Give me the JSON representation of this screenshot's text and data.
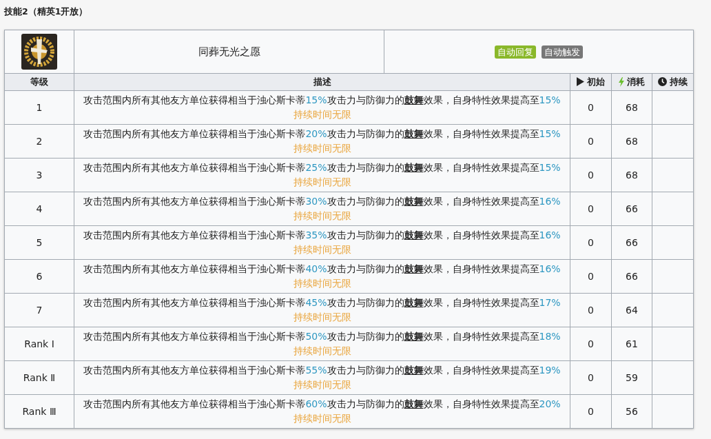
{
  "section_title": "技能2（精英1开放）",
  "skill": {
    "name": "同葬无光之愿",
    "tags": [
      {
        "label": "自动回复",
        "color": "#8ab82a"
      },
      {
        "label": "自动触发",
        "color": "#777777"
      }
    ]
  },
  "columns": [
    {
      "label": "等级"
    },
    {
      "label": "描述"
    },
    {
      "label": "初始"
    },
    {
      "label": "消耗"
    },
    {
      "label": "持续"
    }
  ],
  "rows": [
    {
      "level": "1",
      "description": [
        {
          "kind": "text",
          "text": "攻击范围内所有其他友方单位获得相当于浊心斯卡蒂"
        },
        {
          "kind": "value",
          "text": "15%"
        },
        {
          "kind": "text",
          "text": "攻击力与防御力的"
        },
        {
          "kind": "term",
          "text": "鼓舞"
        },
        {
          "kind": "text",
          "text": "效果，自身特性效果提高至"
        },
        {
          "kind": "value",
          "text": "15%"
        }
      ],
      "duration_note": "持续时间无限",
      "initial": "0",
      "cost": "68"
    },
    {
      "level": "2",
      "description": [
        {
          "kind": "text",
          "text": "攻击范围内所有其他友方单位获得相当于浊心斯卡蒂"
        },
        {
          "kind": "value",
          "text": "20%"
        },
        {
          "kind": "text",
          "text": "攻击力与防御力的"
        },
        {
          "kind": "term",
          "text": "鼓舞"
        },
        {
          "kind": "text",
          "text": "效果，自身特性效果提高至"
        },
        {
          "kind": "value",
          "text": "15%"
        }
      ],
      "duration_note": "持续时间无限",
      "initial": "0",
      "cost": "68"
    },
    {
      "level": "3",
      "description": [
        {
          "kind": "text",
          "text": "攻击范围内所有其他友方单位获得相当于浊心斯卡蒂"
        },
        {
          "kind": "value",
          "text": "25%"
        },
        {
          "kind": "text",
          "text": "攻击力与防御力的"
        },
        {
          "kind": "term",
          "text": "鼓舞"
        },
        {
          "kind": "text",
          "text": "效果，自身特性效果提高至"
        },
        {
          "kind": "value",
          "text": "15%"
        }
      ],
      "duration_note": "持续时间无限",
      "initial": "0",
      "cost": "68"
    },
    {
      "level": "4",
      "description": [
        {
          "kind": "text",
          "text": "攻击范围内所有其他友方单位获得相当于浊心斯卡蒂"
        },
        {
          "kind": "value",
          "text": "30%"
        },
        {
          "kind": "text",
          "text": "攻击力与防御力的"
        },
        {
          "kind": "term",
          "text": "鼓舞"
        },
        {
          "kind": "text",
          "text": "效果，自身特性效果提高至"
        },
        {
          "kind": "value",
          "text": "16%"
        }
      ],
      "duration_note": "持续时间无限",
      "initial": "0",
      "cost": "66"
    },
    {
      "level": "5",
      "description": [
        {
          "kind": "text",
          "text": "攻击范围内所有其他友方单位获得相当于浊心斯卡蒂"
        },
        {
          "kind": "value",
          "text": "35%"
        },
        {
          "kind": "text",
          "text": "攻击力与防御力的"
        },
        {
          "kind": "term",
          "text": "鼓舞"
        },
        {
          "kind": "text",
          "text": "效果，自身特性效果提高至"
        },
        {
          "kind": "value",
          "text": "16%"
        }
      ],
      "duration_note": "持续时间无限",
      "initial": "0",
      "cost": "66"
    },
    {
      "level": "6",
      "description": [
        {
          "kind": "text",
          "text": "攻击范围内所有其他友方单位获得相当于浊心斯卡蒂"
        },
        {
          "kind": "value",
          "text": "40%"
        },
        {
          "kind": "text",
          "text": "攻击力与防御力的"
        },
        {
          "kind": "term",
          "text": "鼓舞"
        },
        {
          "kind": "text",
          "text": "效果，自身特性效果提高至"
        },
        {
          "kind": "value",
          "text": "16%"
        }
      ],
      "duration_note": "持续时间无限",
      "initial": "0",
      "cost": "66"
    },
    {
      "level": "7",
      "description": [
        {
          "kind": "text",
          "text": "攻击范围内所有其他友方单位获得相当于浊心斯卡蒂"
        },
        {
          "kind": "value",
          "text": "45%"
        },
        {
          "kind": "text",
          "text": "攻击力与防御力的"
        },
        {
          "kind": "term",
          "text": "鼓舞"
        },
        {
          "kind": "text",
          "text": "效果，自身特性效果提高至"
        },
        {
          "kind": "value",
          "text": "17%"
        }
      ],
      "duration_note": "持续时间无限",
      "initial": "0",
      "cost": "64"
    },
    {
      "level": "Rank Ⅰ",
      "description": [
        {
          "kind": "text",
          "text": "攻击范围内所有其他友方单位获得相当于浊心斯卡蒂"
        },
        {
          "kind": "value",
          "text": "50%"
        },
        {
          "kind": "text",
          "text": "攻击力与防御力的"
        },
        {
          "kind": "term",
          "text": "鼓舞"
        },
        {
          "kind": "text",
          "text": "效果，自身特性效果提高至"
        },
        {
          "kind": "value",
          "text": "18%"
        }
      ],
      "duration_note": "持续时间无限",
      "initial": "0",
      "cost": "61"
    },
    {
      "level": "Rank Ⅱ",
      "description": [
        {
          "kind": "text",
          "text": "攻击范围内所有其他友方单位获得相当于浊心斯卡蒂"
        },
        {
          "kind": "value",
          "text": "55%"
        },
        {
          "kind": "text",
          "text": "攻击力与防御力的"
        },
        {
          "kind": "term",
          "text": "鼓舞"
        },
        {
          "kind": "text",
          "text": "效果，自身特性效果提高至"
        },
        {
          "kind": "value",
          "text": "19%"
        }
      ],
      "duration_note": "持续时间无限",
      "initial": "0",
      "cost": "59"
    },
    {
      "level": "Rank Ⅲ",
      "description": [
        {
          "kind": "text",
          "text": "攻击范围内所有其他友方单位获得相当于浊心斯卡蒂"
        },
        {
          "kind": "value",
          "text": "60%"
        },
        {
          "kind": "text",
          "text": "攻击力与防御力的"
        },
        {
          "kind": "term",
          "text": "鼓舞"
        },
        {
          "kind": "text",
          "text": "效果，自身特性效果提高至"
        },
        {
          "kind": "value",
          "text": "20%"
        }
      ],
      "duration_note": "持续时间无限",
      "initial": "0",
      "cost": "56"
    }
  ]
}
